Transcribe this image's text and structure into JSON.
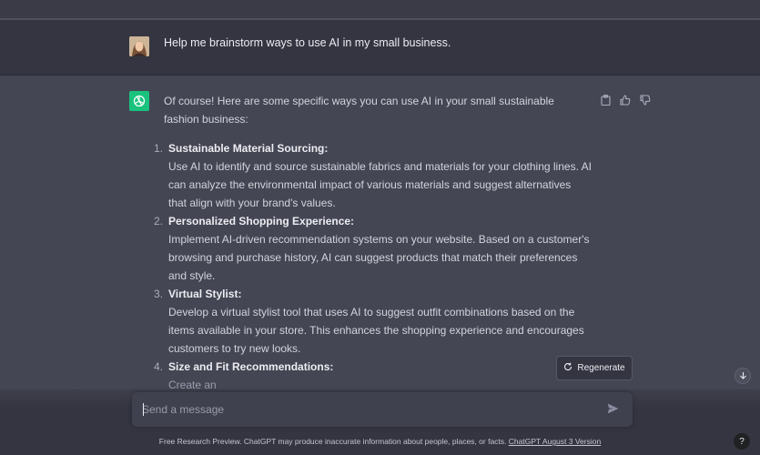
{
  "user_message": {
    "text": "Help me brainstorm ways to use AI in my small business."
  },
  "assistant_message": {
    "intro": "Of course! Here are some specific ways you can use AI in your small sustainable fashion business:",
    "items": [
      {
        "number": "1.",
        "title": "Sustainable Material Sourcing:",
        "body": "Use AI to identify and source sustainable fabrics and materials for your clothing lines. AI can analyze the environmental impact of various materials and suggest alternatives that align with your brand's values."
      },
      {
        "number": "2.",
        "title": "Personalized Shopping Experience:",
        "body": "Implement AI-driven recommendation systems on your website. Based on a customer's browsing and purchase history, AI can suggest products that match their preferences and style."
      },
      {
        "number": "3.",
        "title": "Virtual Stylist:",
        "body": "Develop a virtual stylist tool that uses AI to suggest outfit combinations based on the items available in your store. This enhances the shopping experience and encourages customers to try new looks."
      },
      {
        "number": "4.",
        "title": "Size and Fit Recommendations:",
        "body": "Create an"
      }
    ]
  },
  "actions": {
    "copy_icon": "clipboard-icon",
    "like_icon": "thumbs-up-icon",
    "dislike_icon": "thumbs-down-icon"
  },
  "regenerate": {
    "label": "Regenerate",
    "icon": "refresh-icon"
  },
  "composer": {
    "placeholder": "Send a message",
    "send_icon": "send-icon"
  },
  "footer": {
    "text": "Free Research Preview. ChatGPT may produce inaccurate information about people, places, or facts. ",
    "link": "ChatGPT August 3 Version"
  },
  "help": {
    "label": "?"
  },
  "colors": {
    "accent": "#19c37d",
    "background": "#444654",
    "user_background": "#343541"
  }
}
